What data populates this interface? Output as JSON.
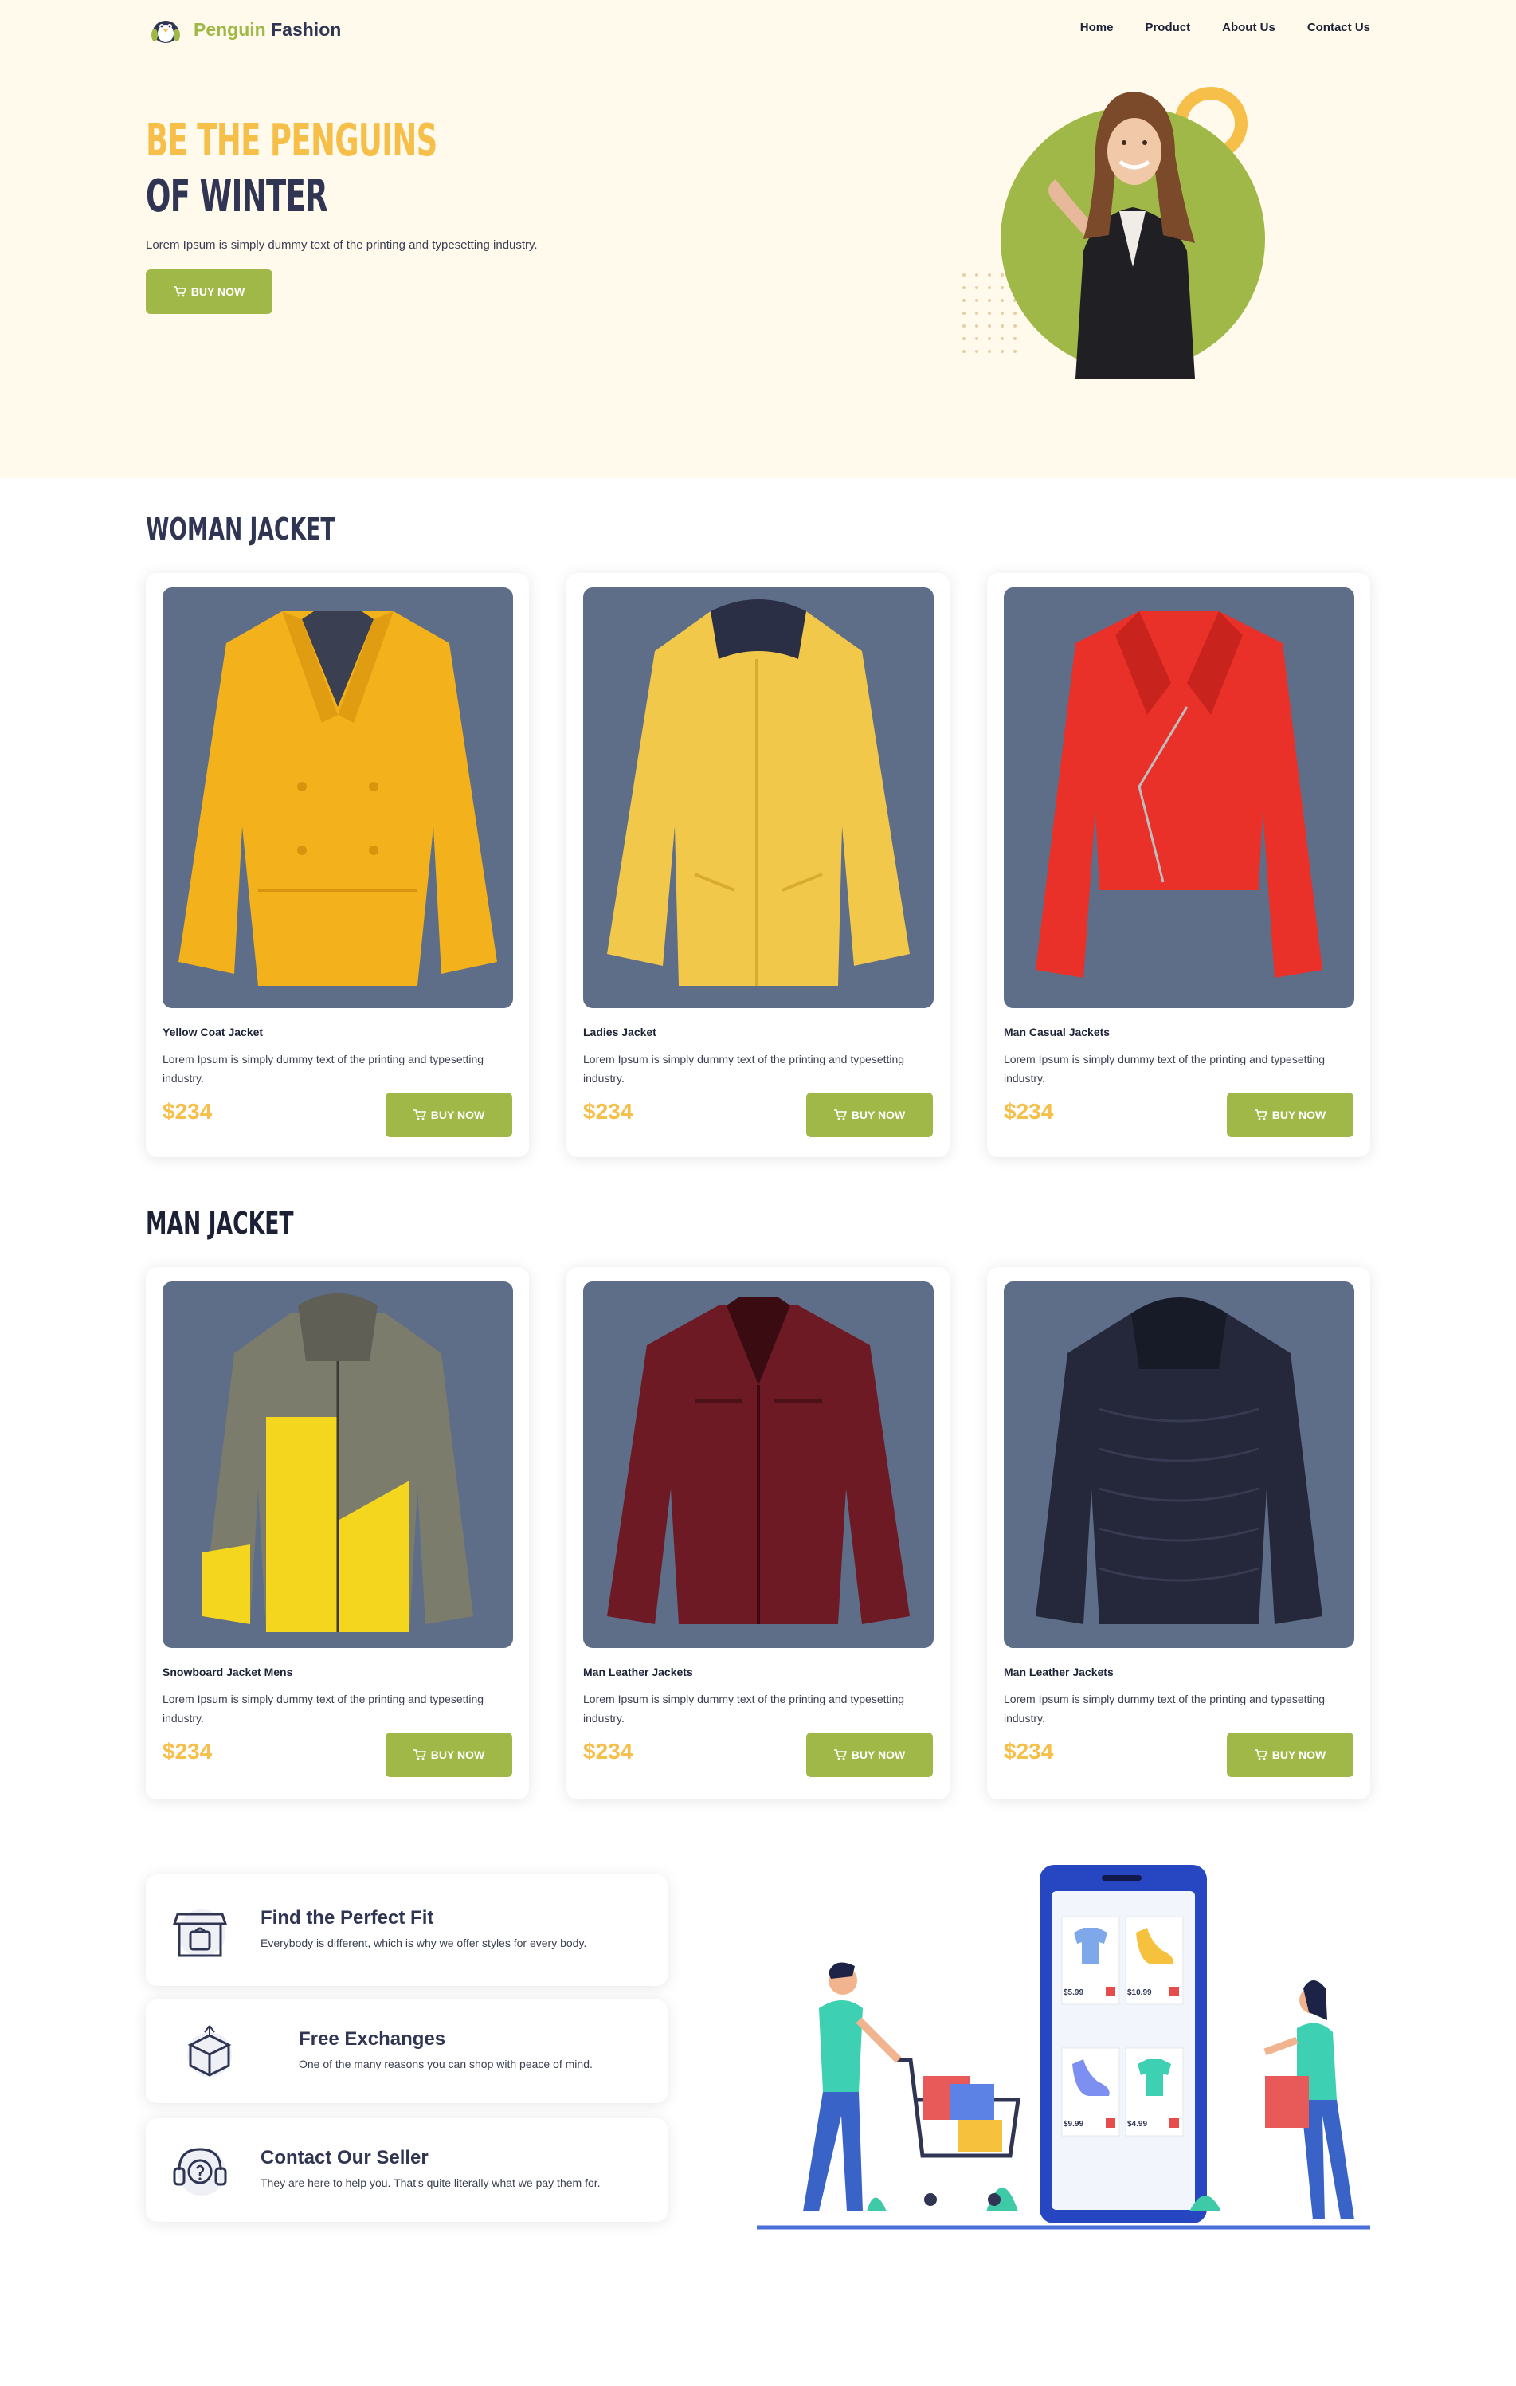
{
  "brand": {
    "part1": "Penguin",
    "part2": "Fashion"
  },
  "nav": {
    "items": [
      "Home",
      "Product",
      "About Us",
      "Contact Us"
    ]
  },
  "hero": {
    "title_line1": "BE THE PENGUINS",
    "title_line2": "OF WINTER",
    "subtitle": "Lorem Ipsum is simply dummy text of the printing and typesetting industry.",
    "button": "BUY NOW"
  },
  "sections": {
    "woman": {
      "title": "WOMAN JACKET",
      "products": [
        {
          "name": "Yellow Coat Jacket",
          "desc": "Lorem Ipsum is simply dummy text of the printing and typesetting industry.",
          "price": "$234",
          "button": "BUY NOW"
        },
        {
          "name": "Ladies Jacket",
          "desc": "Lorem Ipsum is simply dummy text of the printing and typesetting industry.",
          "price": "$234",
          "button": "BUY NOW"
        },
        {
          "name": "Man Casual Jackets",
          "desc": "Lorem Ipsum is simply dummy text of the printing and typesetting industry.",
          "price": "$234",
          "button": "BUY NOW"
        }
      ]
    },
    "man": {
      "title": "MAN JACKET",
      "products": [
        {
          "name": "Snowboard Jacket Mens",
          "desc": "Lorem Ipsum is simply dummy text of the printing and typesetting industry.",
          "price": "$234",
          "button": "BUY NOW"
        },
        {
          "name": "Man Leather Jackets",
          "desc": "Lorem Ipsum is simply dummy text of the printing and typesetting industry.",
          "price": "$234",
          "button": "BUY NOW"
        },
        {
          "name": "Man Leather Jackets",
          "desc": "Lorem Ipsum is simply dummy text of the printing and typesetting industry.",
          "price": "$234",
          "button": "BUY NOW"
        }
      ]
    }
  },
  "features": [
    {
      "title": "Find the Perfect Fit",
      "desc": "Everybody is different, which is why we offer styles for every body.",
      "icon": "store-icon"
    },
    {
      "title": "Free Exchanges",
      "desc": "One of the many reasons you can shop with peace of mind.",
      "icon": "box-icon"
    },
    {
      "title": "Contact Our Seller",
      "desc": "They are here to help you. That's quite literally what we pay them for.",
      "icon": "support-icon"
    }
  ],
  "shop_illustration": {
    "prices": [
      "$5.99",
      "$10.99",
      "$9.99",
      "$4.99"
    ]
  },
  "colors": {
    "accent_green": "#a0b847",
    "accent_yellow": "#f6bf4a",
    "navy": "#2f3553",
    "hero_bg": "#fffaec",
    "card_img_bg": "#5e6d88"
  }
}
